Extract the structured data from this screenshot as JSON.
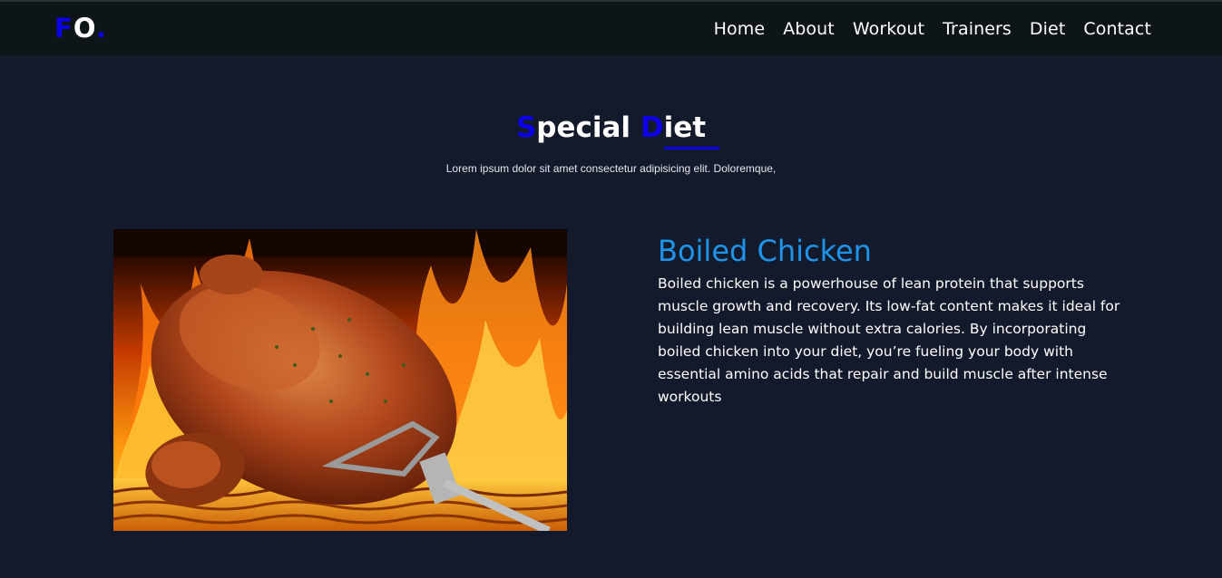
{
  "brand": {
    "part1": "F",
    "part2": "O",
    "part3": "."
  },
  "nav": [
    {
      "label": "Home"
    },
    {
      "label": "About"
    },
    {
      "label": "Workout"
    },
    {
      "label": "Trainers"
    },
    {
      "label": "Diet"
    },
    {
      "label": "Contact"
    }
  ],
  "section": {
    "title_first_letter": "S",
    "title_rest1": "pecial ",
    "title_second_letter": "D",
    "title_rest2": "iet",
    "subtitle": "Lorem ipsum dolor sit amet consectetur adipisicing elit. Doloremque,"
  },
  "dish": {
    "title": "Boiled Chicken",
    "description": "Boiled chicken is a powerhouse of lean protein that supports muscle growth and recovery. Its low-fat content makes it ideal for building lean muscle without extra calories. By incorporating boiled chicken into your diet, you’re fueling your body with essential amino acids that repair and build muscle after intense workouts"
  },
  "colors": {
    "accent": "#0b00e8",
    "dish_title": "#1e95eb",
    "background": "#131a2b",
    "navbar": "#0e1518"
  }
}
